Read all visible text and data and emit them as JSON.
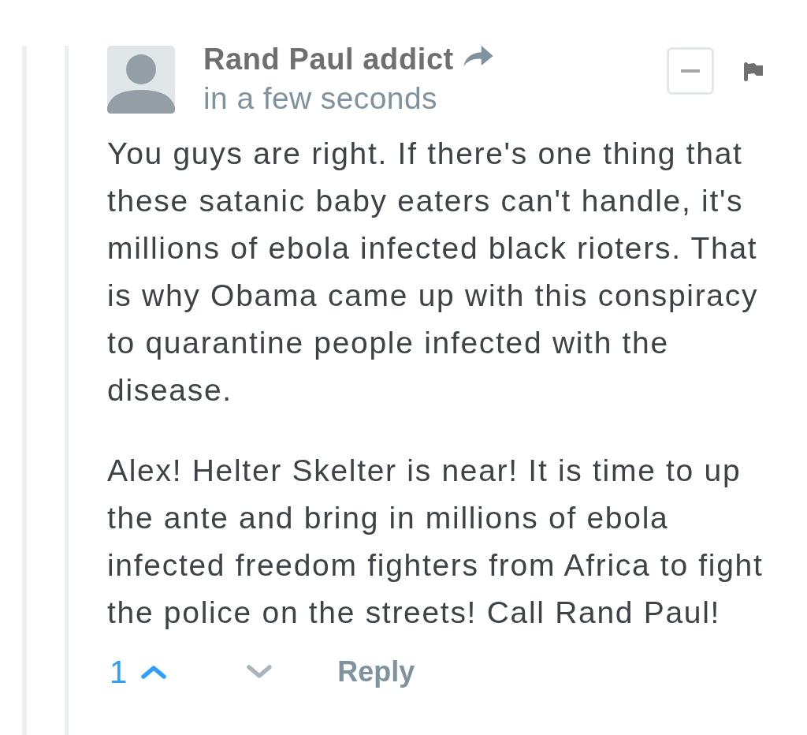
{
  "comment": {
    "author": "Rand Paul addict",
    "time": "in a few seconds",
    "paragraphs": [
      "You guys are right. If there's one thing that these satanic baby eaters can't handle, it's millions of ebola infected black rioters. That is why Obama came up with this conspiracy to quarantine people infected with the disease.",
      "Alex! Helter Skelter is near! It is time to up the ante and bring in millions of ebola infected freedom fighters from Africa to fight the police on the streets! Call Rand Paul!"
    ],
    "votes": {
      "count": "1",
      "upvoted": true,
      "downvoted": false
    },
    "reply": "Reply"
  }
}
